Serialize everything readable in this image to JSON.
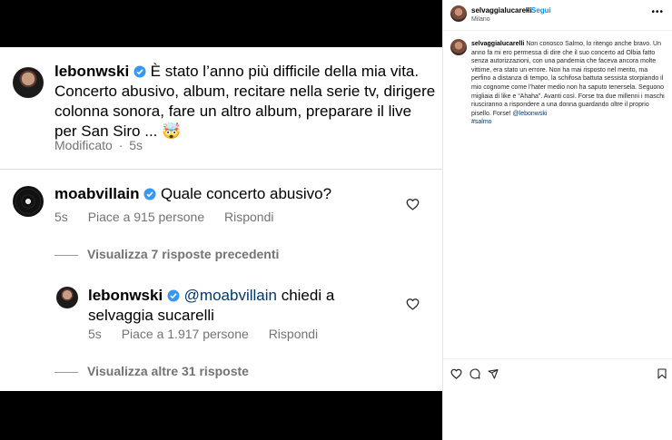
{
  "post": {
    "username": "lebonwski",
    "text": "È stato l’anno più difficile della mia vita. Concerto abusivo, album, recitare nella serie tv, dirigere colonna sonora, fare un altro album, preparare il live per San Siro ... 🤯",
    "edited": "Modificato",
    "time": "5s"
  },
  "comment": {
    "username": "moabvillain",
    "text": "Quale concerto abusivo?",
    "time": "5s",
    "likes": "Piace a 915 persone",
    "reply": "Rispondi"
  },
  "view_previous": "Visualizza 7 risposte precedenti",
  "reply": {
    "username": "lebonwski",
    "mention": "@moabvillain",
    "text": "chiedi a selvaggia sucarelli",
    "time": "5s",
    "likes": "Piace a 1.917 persone",
    "reply": "Rispondi"
  },
  "view_more": "Visualizza altre 31 risposte",
  "instagram": {
    "username": "selvaggialucarelli",
    "dot": "•",
    "follow": "Segui",
    "location": "Milano",
    "caption_user": "selvaggialucarelli",
    "caption": "Non conosco Salmo, lo ritengo anche bravo. Un anno fa mi ero permessa di dire che il suo concerto ad Olbia fatto senza autorizzazioni, con una pandemia che faceva ancora molte vittime, era stato un errore. Non ha mai risposto nel merito, ma perfino a distanza di tempo, la schifosa battuta sessista storpiando il mio cognome come l’hater medio non ha saputo tenersela. Seguono migliaia di like e “Ahaha”. Avanti così. Forse tra due millenni i maschi riusciranno a rispondere a una donna guardando oltre il proprio pisello. Forse!",
    "caption_mention": "@lebonwski",
    "hashtag": "#salmo"
  },
  "colors": {
    "verified": "#3897f0",
    "link": "#00376b",
    "follow": "#0095f6",
    "meta": "#737373"
  }
}
